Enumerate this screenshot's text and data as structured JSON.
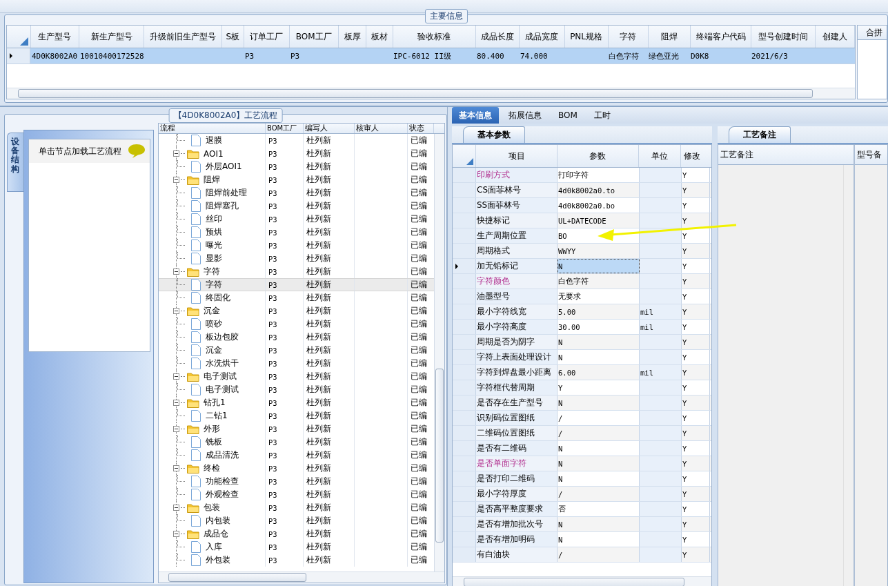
{
  "main_info": {
    "title": "主要信息",
    "columns": [
      "生产型号",
      "新生产型号",
      "升级前旧生产型号",
      "S板",
      "订单工厂",
      "BOM工厂",
      "板厚",
      "板材",
      "验收标准",
      "成品长度",
      "成品宽度",
      "PNL规格",
      "字符",
      "阻焊",
      "终端客户代码",
      "型号创建时间",
      "创建人"
    ],
    "rows": [
      {
        "selected": true,
        "cells": [
          "4D0K8002A0",
          "10010400172528",
          null,
          null,
          "P3",
          "P3",
          null,
          null,
          "IPC-6012 II级",
          "80.400",
          "74.000",
          null,
          "白色字符",
          "绿色亚光",
          "D0K8",
          "2021/6/3",
          null
        ]
      }
    ],
    "side_column": "合拼"
  },
  "left_tab": "设备结构",
  "node_list": {
    "hint": "单击节点加载工艺流程"
  },
  "flow": {
    "title": "【4D0K8002A0】工艺流程",
    "columns": [
      "流程",
      "BOM工厂",
      "编写人",
      "核审人",
      "状态"
    ],
    "nodes": [
      {
        "kind": "step",
        "label": "退膜",
        "factory": "P3",
        "author": "杜列新",
        "status": "已编",
        "selected": false
      },
      {
        "kind": "group",
        "label": "AOI1",
        "factory": "P3",
        "author": "杜列新",
        "status": "已编",
        "selected": false,
        "expanded": true,
        "children": [
          {
            "kind": "step",
            "label": "外层AOI1",
            "factory": "P3",
            "author": "杜列新",
            "status": "已编",
            "selected": false
          }
        ]
      },
      {
        "kind": "group",
        "label": "阻焊",
        "factory": "P3",
        "author": "杜列新",
        "status": "已编",
        "selected": false,
        "expanded": true,
        "children": [
          {
            "kind": "step",
            "label": "阻焊前处理",
            "factory": "P3",
            "author": "杜列新",
            "status": "已编",
            "selected": false
          },
          {
            "kind": "step",
            "label": "阻焊塞孔",
            "factory": "P3",
            "author": "杜列新",
            "status": "已编",
            "selected": false
          },
          {
            "kind": "step",
            "label": "丝印",
            "factory": "P3",
            "author": "杜列新",
            "status": "已编",
            "selected": false
          },
          {
            "kind": "step",
            "label": "预烘",
            "factory": "P3",
            "author": "杜列新",
            "status": "已编",
            "selected": false
          },
          {
            "kind": "step",
            "label": "曝光",
            "factory": "P3",
            "author": "杜列新",
            "status": "已编",
            "selected": false
          },
          {
            "kind": "step",
            "label": "显影",
            "factory": "P3",
            "author": "杜列新",
            "status": "已编",
            "selected": false
          }
        ]
      },
      {
        "kind": "group",
        "label": "字符",
        "factory": "P3",
        "author": "杜列新",
        "status": "已编",
        "selected": false,
        "expanded": true,
        "children": [
          {
            "kind": "step",
            "label": "字符",
            "factory": "P3",
            "author": "杜列新",
            "status": "已编",
            "selected": true
          },
          {
            "kind": "step",
            "label": "终固化",
            "factory": "P3",
            "author": "杜列新",
            "status": "已编",
            "selected": false
          }
        ]
      },
      {
        "kind": "group",
        "label": "沉金",
        "factory": "P3",
        "author": "杜列新",
        "status": "已编",
        "selected": false,
        "expanded": true,
        "children": [
          {
            "kind": "step",
            "label": "喷砂",
            "factory": "P3",
            "author": "杜列新",
            "status": "已编",
            "selected": false
          },
          {
            "kind": "step",
            "label": "板边包胶",
            "factory": "P3",
            "author": "杜列新",
            "status": "已编",
            "selected": false
          },
          {
            "kind": "step",
            "label": "沉金",
            "factory": "P3",
            "author": "杜列新",
            "status": "已编",
            "selected": false
          },
          {
            "kind": "step",
            "label": "水洗烘干",
            "factory": "P3",
            "author": "杜列新",
            "status": "已编",
            "selected": false
          }
        ]
      },
      {
        "kind": "group",
        "label": "电子测试",
        "factory": "P3",
        "author": "杜列新",
        "status": "已编",
        "selected": false,
        "expanded": true,
        "children": [
          {
            "kind": "step",
            "label": "电子测试",
            "factory": "P3",
            "author": "杜列新",
            "status": "已编",
            "selected": false
          }
        ]
      },
      {
        "kind": "group",
        "label": "钻孔1",
        "factory": "P3",
        "author": "杜列新",
        "status": "已编",
        "selected": false,
        "expanded": true,
        "children": [
          {
            "kind": "step",
            "label": "二钻1",
            "factory": "P3",
            "author": "杜列新",
            "status": "已编",
            "selected": false
          }
        ]
      },
      {
        "kind": "group",
        "label": "外形",
        "factory": "P3",
        "author": "杜列新",
        "status": "已编",
        "selected": false,
        "expanded": true,
        "children": [
          {
            "kind": "step",
            "label": "铣板",
            "factory": "P3",
            "author": "杜列新",
            "status": "已编",
            "selected": false
          },
          {
            "kind": "step",
            "label": "成品清洗",
            "factory": "P3",
            "author": "杜列新",
            "status": "已编",
            "selected": false
          }
        ]
      },
      {
        "kind": "group",
        "label": "终检",
        "factory": "P3",
        "author": "杜列新",
        "status": "已编",
        "selected": false,
        "expanded": true,
        "children": [
          {
            "kind": "step",
            "label": "功能检查",
            "factory": "P3",
            "author": "杜列新",
            "status": "已编",
            "selected": false
          },
          {
            "kind": "step",
            "label": "外观检查",
            "factory": "P3",
            "author": "杜列新",
            "status": "已编",
            "selected": false
          }
        ]
      },
      {
        "kind": "group",
        "label": "包装",
        "factory": "P3",
        "author": "杜列新",
        "status": "已编",
        "selected": false,
        "expanded": true,
        "children": [
          {
            "kind": "step",
            "label": "内包装",
            "factory": "P3",
            "author": "杜列新",
            "status": "已编",
            "selected": false
          }
        ]
      },
      {
        "kind": "group",
        "label": "成品仓",
        "factory": "P3",
        "author": "杜列新",
        "status": "已编",
        "selected": false,
        "expanded": true,
        "children": [
          {
            "kind": "step",
            "label": "入库",
            "factory": "P3",
            "author": "杜列新",
            "status": "已编",
            "selected": false
          },
          {
            "kind": "step",
            "label": "外包装",
            "factory": "P3",
            "author": "杜列新",
            "status": "已编",
            "selected": false
          }
        ]
      }
    ]
  },
  "tabs": [
    {
      "label": "基本信息",
      "selected": true
    },
    {
      "label": "拓展信息",
      "selected": false
    },
    {
      "label": "BOM",
      "selected": false
    },
    {
      "label": "工时",
      "selected": false
    }
  ],
  "params": {
    "tab": "基本参数",
    "columns": [
      "项目",
      "参数",
      "单位",
      "修改"
    ],
    "rows": [
      {
        "item": "印刷方式",
        "value": "打印字符",
        "unit": null,
        "edit": "Y",
        "highlighted": true,
        "selected": false
      },
      {
        "item": "CS面菲林号",
        "value": "4d0k8002a0.to",
        "unit": null,
        "edit": "Y",
        "highlighted": false,
        "selected": false
      },
      {
        "item": "SS面菲林号",
        "value": "4d0k8002a0.bo",
        "unit": null,
        "edit": "Y",
        "highlighted": false,
        "selected": false
      },
      {
        "item": "快捷标记",
        "value": "UL+DATECODE",
        "unit": null,
        "edit": "Y",
        "highlighted": false,
        "selected": false
      },
      {
        "item": "生产周期位置",
        "value": "BO",
        "unit": null,
        "edit": "Y",
        "highlighted": false,
        "selected": false
      },
      {
        "item": "周期格式",
        "value": "WWYY",
        "unit": null,
        "edit": "Y",
        "highlighted": false,
        "selected": false
      },
      {
        "item": "加无铅标记",
        "value": "N",
        "unit": null,
        "edit": "Y",
        "highlighted": false,
        "selected": true
      },
      {
        "item": "字符颜色",
        "value": "白色字符",
        "unit": null,
        "edit": "Y",
        "highlighted": true,
        "selected": false
      },
      {
        "item": "油墨型号",
        "value": "无要求",
        "unit": null,
        "edit": "Y",
        "highlighted": false,
        "selected": false
      },
      {
        "item": "最小字符线宽",
        "value": "5.00",
        "unit": "mil",
        "edit": "Y",
        "highlighted": false,
        "selected": false
      },
      {
        "item": "最小字符高度",
        "value": "30.00",
        "unit": "mil",
        "edit": "Y",
        "highlighted": false,
        "selected": false
      },
      {
        "item": "周期是否为阴字",
        "value": "N",
        "unit": null,
        "edit": "Y",
        "highlighted": false,
        "selected": false
      },
      {
        "item": "字符上表面处理设计",
        "value": "N",
        "unit": null,
        "edit": "Y",
        "highlighted": false,
        "selected": false
      },
      {
        "item": "字符到焊盘最小距离",
        "value": "6.00",
        "unit": "mil",
        "edit": "Y",
        "highlighted": false,
        "selected": false
      },
      {
        "item": "字符框代替周期",
        "value": "Y",
        "unit": null,
        "edit": "Y",
        "highlighted": false,
        "selected": false
      },
      {
        "item": "是否存在生产型号",
        "value": "N",
        "unit": null,
        "edit": "Y",
        "highlighted": false,
        "selected": false
      },
      {
        "item": "识别码位置图纸",
        "value": "/",
        "unit": null,
        "edit": "Y",
        "highlighted": false,
        "selected": false
      },
      {
        "item": "二维码位置图纸",
        "value": "/",
        "unit": null,
        "edit": "Y",
        "highlighted": false,
        "selected": false
      },
      {
        "item": "是否有二维码",
        "value": "N",
        "unit": null,
        "edit": "Y",
        "highlighted": false,
        "selected": false
      },
      {
        "item": "是否单面字符",
        "value": "N",
        "unit": null,
        "edit": "Y",
        "highlighted": true,
        "selected": false
      },
      {
        "item": "是否打印二维码",
        "value": "N",
        "unit": null,
        "edit": "Y",
        "highlighted": false,
        "selected": false
      },
      {
        "item": "最小字符厚度",
        "value": "/",
        "unit": null,
        "edit": "Y",
        "highlighted": false,
        "selected": false
      },
      {
        "item": "是否高平整度要求",
        "value": "否",
        "unit": null,
        "edit": "Y",
        "highlighted": false,
        "selected": false
      },
      {
        "item": "是否有增加批次号",
        "value": "N",
        "unit": null,
        "edit": "Y",
        "highlighted": false,
        "selected": false
      },
      {
        "item": "是否有增加明码",
        "value": "N",
        "unit": null,
        "edit": "Y",
        "highlighted": false,
        "selected": false
      },
      {
        "item": "有白油块",
        "value": "/",
        "unit": null,
        "edit": "Y",
        "highlighted": false,
        "selected": false
      }
    ]
  },
  "notes": {
    "tab": "工艺备注",
    "columns": [
      "工艺备注",
      "型号备"
    ]
  }
}
